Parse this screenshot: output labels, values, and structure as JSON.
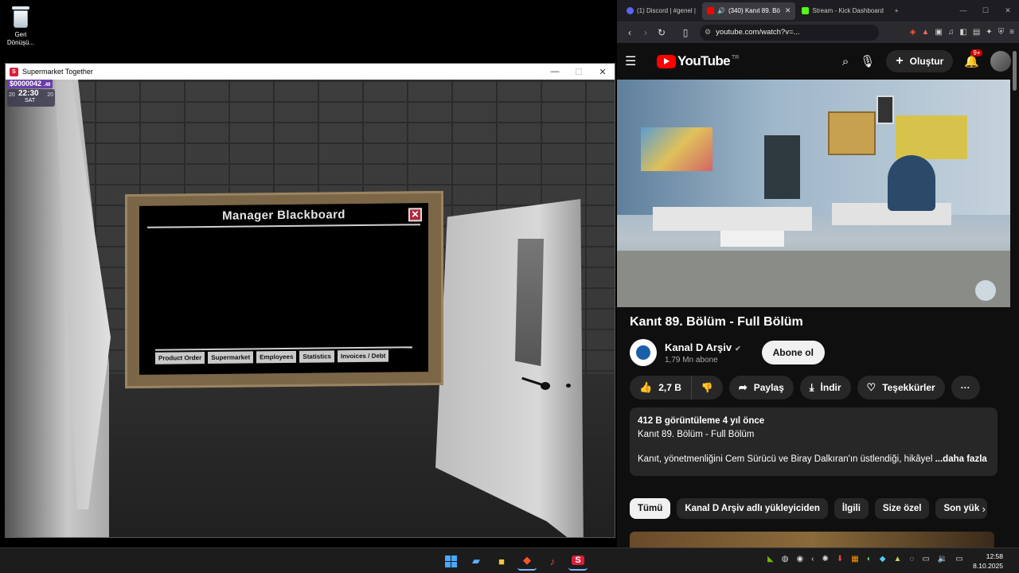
{
  "desktop": {
    "recycle_bin_label": "Geri Dönüşü..."
  },
  "game_window": {
    "title": "Supermarket Together",
    "controls": [
      "—",
      "☐",
      "✕"
    ],
    "hud": {
      "money": "$0000042",
      "money_cents": ".49",
      "clock": "22:30",
      "day": "SAT",
      "day_left": "20",
      "day_right": "20"
    },
    "blackboard": {
      "title": "Manager Blackboard",
      "close": "✕",
      "tabs": [
        "Product Order",
        "Supermarket",
        "Employees",
        "Statistics",
        "Invoices / Debt"
      ]
    }
  },
  "browser": {
    "tabs": [
      {
        "label": "(1) Discord | #genel |",
        "active": false,
        "color": "#5865f2"
      },
      {
        "label": "(340) Kanıt 89. Bö",
        "active": true,
        "color": "#ff0000"
      },
      {
        "label": "Stream - Kick Dashboard",
        "active": false,
        "color": "#53fc18"
      }
    ],
    "new_tab": "+",
    "window_controls": [
      "—",
      "☐",
      "✕"
    ],
    "url": "youtube.com/watch?v=..."
  },
  "youtube": {
    "logo_text": "YouTube",
    "country": "TR",
    "create_label": "Oluştur",
    "notif_badge": "9+",
    "video": {
      "title": "Kanıt 89. Bölüm - Full Bölüm"
    },
    "channel": {
      "name": "Kanal D Arşiv",
      "subscribers": "1,79 Mn abone",
      "subscribe_label": "Abone ol"
    },
    "actions": {
      "likes": "2,7 B",
      "share": "Paylaş",
      "download": "İndir",
      "thanks": "Teşekkürler",
      "more": "···"
    },
    "description": {
      "stats": "412 B görüntüleme  4 yıl önce",
      "line2": "Kanıt 89. Bölüm - Full Bölüm",
      "line3": "Kanıt, yönetmenliğini Cem Sürücü ve Biray Dalkıran'ın üstlendiği, hikâyel",
      "more": "...daha fazla"
    },
    "chips": [
      "Tümü",
      "Kanal D Arşiv adlı yükleyiciden",
      "İlgili",
      "Size özel",
      "Son yük"
    ]
  },
  "taskbar": {
    "time": "12:58",
    "date": "8.10.2025"
  },
  "colors": {
    "yt_red": "#ff0000",
    "accent_blue": "#4aa8ff"
  }
}
